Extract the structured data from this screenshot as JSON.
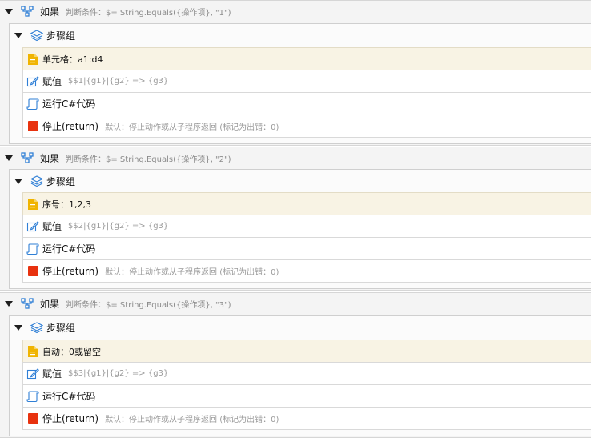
{
  "blocks": [
    {
      "if_title": "如果",
      "condition": "判断条件：$= String.Equals({操作项}, \"1\")",
      "group_title": "步骤组",
      "note": "单元格：a1:d4",
      "assign_label": "赋值",
      "assign_hint": "$$1|{g1}|{g2} => {g3}",
      "code_label": "运行C#代码",
      "stop_label": "停止(return)",
      "stop_hint": "默认：停止动作或从子程序返回 (标记为出错：0)"
    },
    {
      "if_title": "如果",
      "condition": "判断条件：$= String.Equals({操作项}, \"2\")",
      "group_title": "步骤组",
      "note": "序号：1,2,3",
      "assign_label": "赋值",
      "assign_hint": "$$2|{g1}|{g2} => {g3}",
      "code_label": "运行C#代码",
      "stop_label": "停止(return)",
      "stop_hint": "默认：停止动作或从子程序返回 (标记为出错：0)"
    },
    {
      "if_title": "如果",
      "condition": "判断条件：$= String.Equals({操作项}, \"3\")",
      "group_title": "步骤组",
      "note": "自动：0或留空",
      "assign_label": "赋值",
      "assign_hint": "$$3|{g1}|{g2} => {g3}",
      "code_label": "运行C#代码",
      "stop_label": "停止(return)",
      "stop_hint": "默认：停止动作或从子程序返回 (标记为出错：0)"
    }
  ],
  "icons": {
    "if": "branch-icon",
    "group": "layers-icon",
    "note": "note-icon",
    "assign": "edit-icon",
    "code": "script-icon",
    "stop": "stop-icon"
  },
  "colors": {
    "branch_icon": "#2f7fd6",
    "layers_icon": "#2f7fd6",
    "note_icon": "#f0b400",
    "stop_icon": "#e8320f",
    "note_bg": "#f8f3e4"
  }
}
